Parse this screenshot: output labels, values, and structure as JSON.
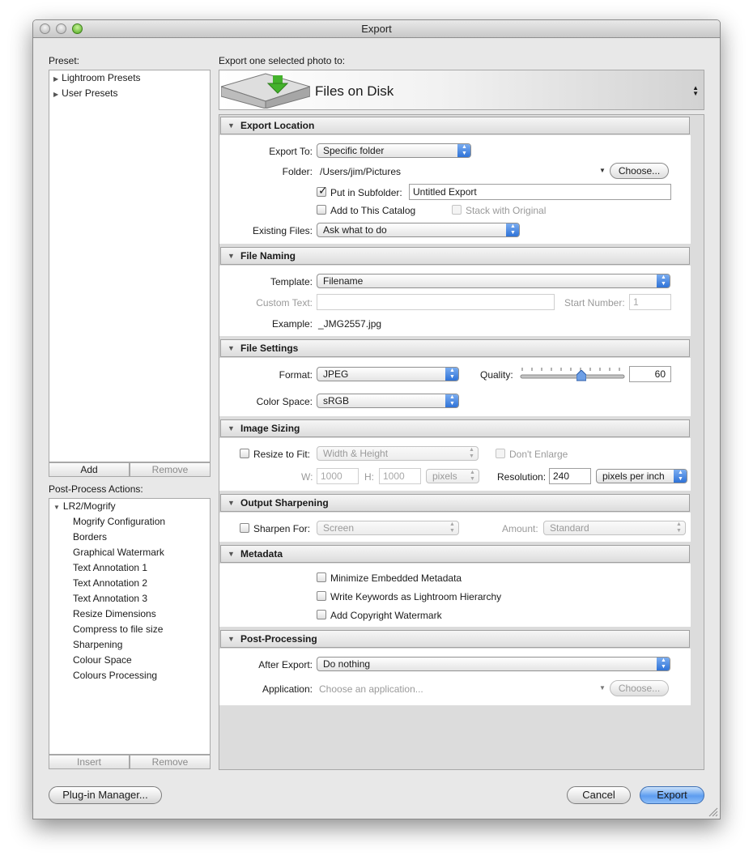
{
  "window": {
    "title": "Export"
  },
  "preset": {
    "label": "Preset:",
    "items": [
      "Lightroom Presets",
      "User Presets"
    ],
    "add_label": "Add",
    "remove_label": "Remove"
  },
  "post_process_actions": {
    "label": "Post-Process Actions:",
    "group": "LR2/Mogrify",
    "items": [
      "Mogrify Configuration",
      "Borders",
      "Graphical Watermark",
      "Text Annotation 1",
      "Text Annotation 2",
      "Text Annotation 3",
      "Resize Dimensions",
      "Compress to file size",
      "Sharpening",
      "Colour Space",
      "Colours Processing"
    ],
    "insert_label": "Insert",
    "remove_label": "Remove"
  },
  "export_header": {
    "label": "Export one selected photo to:",
    "destination": "Files on Disk"
  },
  "export_location": {
    "title": "Export Location",
    "export_to_label": "Export To:",
    "export_to_value": "Specific folder",
    "folder_label": "Folder:",
    "folder_value": "/Users/jim/Pictures",
    "choose_label": "Choose...",
    "subfolder_label": "Put in Subfolder:",
    "subfolder_checked": true,
    "subfolder_value": "Untitled Export",
    "add_catalog_label": "Add to This Catalog",
    "stack_label": "Stack with Original",
    "existing_files_label": "Existing Files:",
    "existing_files_value": "Ask what to do"
  },
  "file_naming": {
    "title": "File Naming",
    "template_label": "Template:",
    "template_value": "Filename",
    "custom_text_label": "Custom Text:",
    "start_number_label": "Start Number:",
    "start_number_value": "1",
    "example_label": "Example:",
    "example_value": "_JMG2557.jpg"
  },
  "file_settings": {
    "title": "File Settings",
    "format_label": "Format:",
    "format_value": "JPEG",
    "quality_label": "Quality:",
    "quality_value": "60",
    "quality_fraction": 0.6,
    "color_space_label": "Color Space:",
    "color_space_value": "sRGB"
  },
  "image_sizing": {
    "title": "Image Sizing",
    "resize_label": "Resize to Fit:",
    "resize_value": "Width & Height",
    "dont_enlarge_label": "Don't Enlarge",
    "w_label": "W:",
    "w_value": "1000",
    "h_label": "H:",
    "h_value": "1000",
    "unit_value": "pixels",
    "resolution_label": "Resolution:",
    "resolution_value": "240",
    "resolution_unit": "pixels per inch"
  },
  "output_sharpening": {
    "title": "Output Sharpening",
    "sharpen_label": "Sharpen For:",
    "sharpen_value": "Screen",
    "amount_label": "Amount:",
    "amount_value": "Standard"
  },
  "metadata": {
    "title": "Metadata",
    "options": [
      "Minimize Embedded Metadata",
      "Write Keywords as Lightroom Hierarchy",
      "Add Copyright Watermark"
    ]
  },
  "post_processing": {
    "title": "Post-Processing",
    "after_export_label": "After Export:",
    "after_export_value": "Do nothing",
    "application_label": "Application:",
    "application_placeholder": "Choose an application...",
    "choose_label": "Choose..."
  },
  "footer": {
    "plugin_manager_label": "Plug-in Manager...",
    "cancel_label": "Cancel",
    "export_label": "Export"
  },
  "colors": {
    "accent": "#2a6fd6",
    "window_bg": "#e8e8e8"
  }
}
